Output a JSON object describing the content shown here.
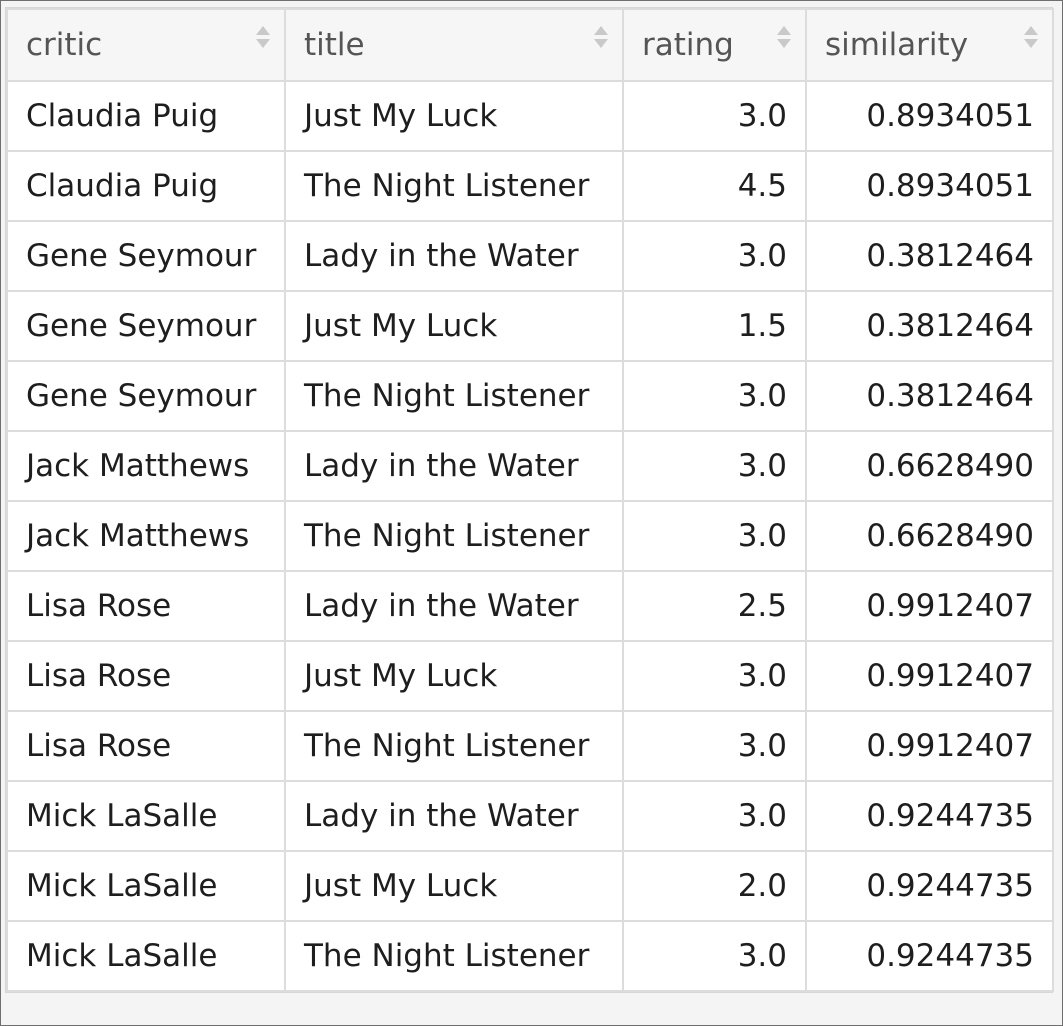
{
  "columns": [
    {
      "key": "critic",
      "label": "critic",
      "align": "left"
    },
    {
      "key": "title",
      "label": "title",
      "align": "left"
    },
    {
      "key": "rating",
      "label": "rating",
      "align": "right"
    },
    {
      "key": "similarity",
      "label": "similarity",
      "align": "right"
    }
  ],
  "rows": [
    {
      "critic": "Claudia Puig",
      "title": "Just My Luck",
      "rating": "3.0",
      "similarity": "0.8934051"
    },
    {
      "critic": "Claudia Puig",
      "title": "The Night Listener",
      "rating": "4.5",
      "similarity": "0.8934051"
    },
    {
      "critic": "Gene Seymour",
      "title": "Lady in the Water",
      "rating": "3.0",
      "similarity": "0.3812464"
    },
    {
      "critic": "Gene Seymour",
      "title": "Just My Luck",
      "rating": "1.5",
      "similarity": "0.3812464"
    },
    {
      "critic": "Gene Seymour",
      "title": "The Night Listener",
      "rating": "3.0",
      "similarity": "0.3812464"
    },
    {
      "critic": "Jack Matthews",
      "title": "Lady in the Water",
      "rating": "3.0",
      "similarity": "0.6628490"
    },
    {
      "critic": "Jack Matthews",
      "title": "The Night Listener",
      "rating": "3.0",
      "similarity": "0.6628490"
    },
    {
      "critic": "Lisa Rose",
      "title": "Lady in the Water",
      "rating": "2.5",
      "similarity": "0.9912407"
    },
    {
      "critic": "Lisa Rose",
      "title": "Just My Luck",
      "rating": "3.0",
      "similarity": "0.9912407"
    },
    {
      "critic": "Lisa Rose",
      "title": "The Night Listener",
      "rating": "3.0",
      "similarity": "0.9912407"
    },
    {
      "critic": "Mick LaSalle",
      "title": "Lady in the Water",
      "rating": "3.0",
      "similarity": "0.9244735"
    },
    {
      "critic": "Mick LaSalle",
      "title": "Just My Luck",
      "rating": "2.0",
      "similarity": "0.9244735"
    },
    {
      "critic": "Mick LaSalle",
      "title": "The Night Listener",
      "rating": "3.0",
      "similarity": "0.9244735"
    }
  ],
  "icons": {
    "sort": "sort-icon"
  },
  "colors": {
    "border": "#dcdcdc",
    "header_bg": "#f6f6f6",
    "text": "#1e1e1e",
    "sort_icon": "#c9c9c9"
  }
}
